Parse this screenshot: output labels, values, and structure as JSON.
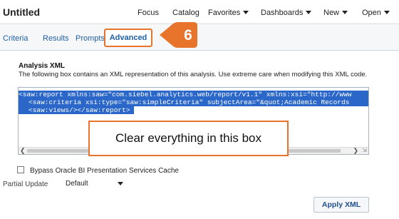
{
  "header": {
    "title": "Untitled",
    "menu": [
      {
        "label": "Focus",
        "has_caret": false
      },
      {
        "label": "Catalog",
        "has_caret": false
      },
      {
        "label": "Favorites",
        "has_caret": true
      },
      {
        "label": "Dashboards",
        "has_caret": true
      },
      {
        "label": "New",
        "has_caret": true
      },
      {
        "label": "Open",
        "has_caret": true
      }
    ]
  },
  "tabs": {
    "criteria": "Criteria",
    "results": "Results",
    "prompts": "Prompts",
    "advanced": "Advanced"
  },
  "callout": {
    "step": "6",
    "color": "#e8742c"
  },
  "analysis_xml": {
    "title": "Analysis XML",
    "description": "The following box contains an XML representation of this analysis. Use extreme care when modifying this XML code.",
    "lines": [
      "<saw:report xmlns:saw=\"com.siebel.analytics.web/report/v1.1\" xmlns:xsi=\"http://www",
      "<saw:criteria xsi:type=\"saw:simpleCriteria\" subjectArea=\"&quot;Academic Records",
      "<saw:views/></saw:report>"
    ]
  },
  "annotation": {
    "text": "Clear everything in this box"
  },
  "options": {
    "bypass_label": "Bypass Oracle BI Presentation Services Cache",
    "bypass_checked": false,
    "partial_label": "Partial Update",
    "partial_value": "Default"
  },
  "actions": {
    "apply": "Apply XML"
  },
  "colors": {
    "accent": "#e8742c",
    "link": "#1f5fa8",
    "selection": "#2a67c9"
  }
}
